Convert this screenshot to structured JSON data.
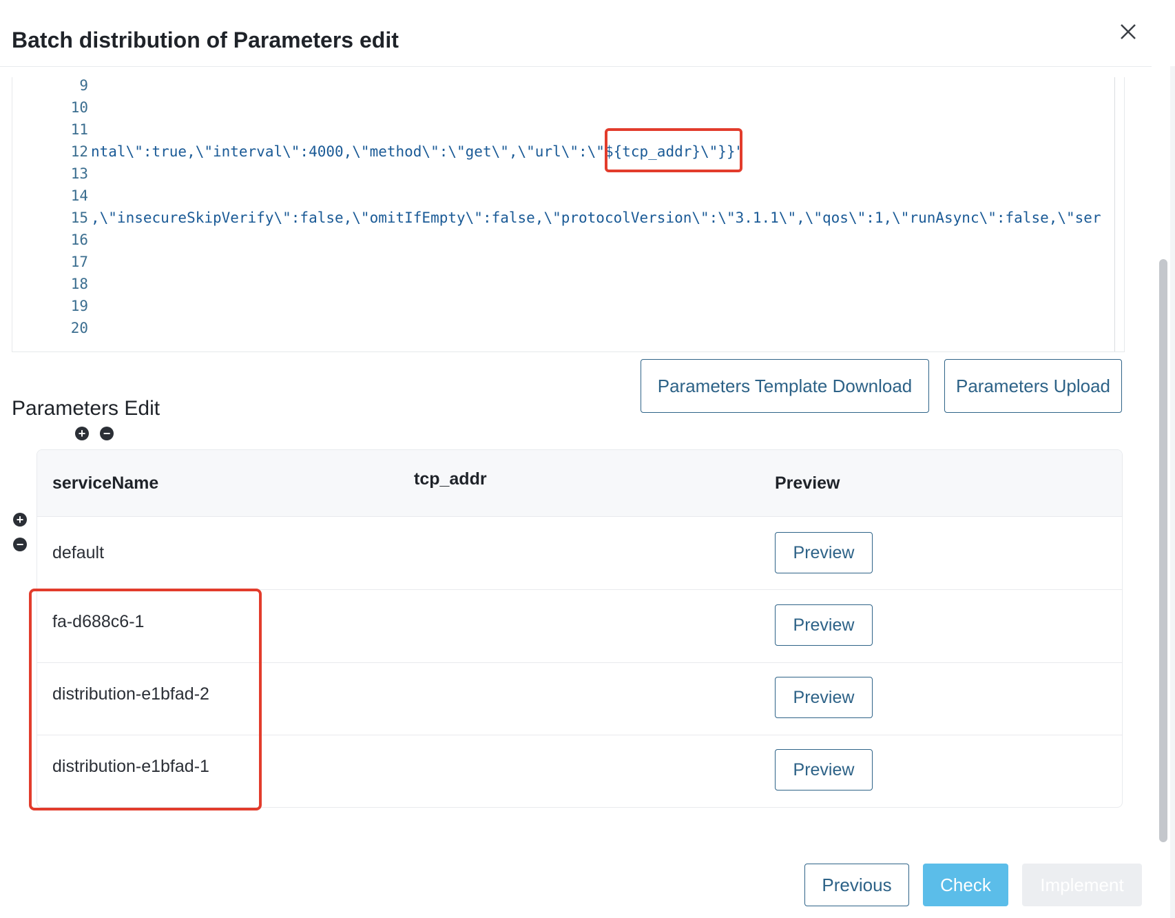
{
  "dialog": {
    "title": "Batch distribution of Parameters edit",
    "close_icon": "close-icon"
  },
  "editor": {
    "lines": [
      {
        "num": "9",
        "code": ""
      },
      {
        "num": "10",
        "code": ""
      },
      {
        "num": "11",
        "code": ""
      },
      {
        "num": "12",
        "code": "ntal\\\":true,\\\"interval\\\":4000,\\\"method\\\":\\\"get\\\",\\\"url\\\":\\\"${tcp_addr}\\\"}}\""
      },
      {
        "num": "13",
        "code": ""
      },
      {
        "num": "14",
        "code": ""
      },
      {
        "num": "15",
        "code": ",\\\"insecureSkipVerify\\\":false,\\\"omitIfEmpty\\\":false,\\\"protocolVersion\\\":\\\"3.1.1\\\",\\\"qos\\\":1,\\\"runAsync\\\":false,\\\"ser"
      },
      {
        "num": "16",
        "code": ""
      },
      {
        "num": "17",
        "code": ""
      },
      {
        "num": "18",
        "code": ""
      },
      {
        "num": "19",
        "code": ""
      },
      {
        "num": "20",
        "code": ""
      }
    ]
  },
  "actions": {
    "template_download": "Parameters Template Download",
    "upload": "Parameters Upload"
  },
  "params": {
    "section_title": "Parameters Edit",
    "add_column_icon": "+",
    "remove_column_icon": "−",
    "add_row_icon": "+",
    "remove_row_icon": "−",
    "columns": [
      "serviceName",
      "tcp_addr",
      "Preview"
    ],
    "rows": [
      {
        "serviceName": "default",
        "tcp_addr": "",
        "preview_label": "Preview"
      },
      {
        "serviceName": "fa-d688c6-1",
        "tcp_addr": "",
        "preview_label": "Preview"
      },
      {
        "serviceName": "distribution-e1bfad-2",
        "tcp_addr": "",
        "preview_label": "Preview"
      },
      {
        "serviceName": "distribution-e1bfad-1",
        "tcp_addr": "",
        "preview_label": "Preview"
      }
    ]
  },
  "footer": {
    "previous": "Previous",
    "check": "Check",
    "implement": "Implement"
  },
  "colors": {
    "accent": "#2d6287",
    "primary_button": "#5bbde9",
    "highlight": "#e23c2c",
    "disabled": "#eceef1"
  }
}
